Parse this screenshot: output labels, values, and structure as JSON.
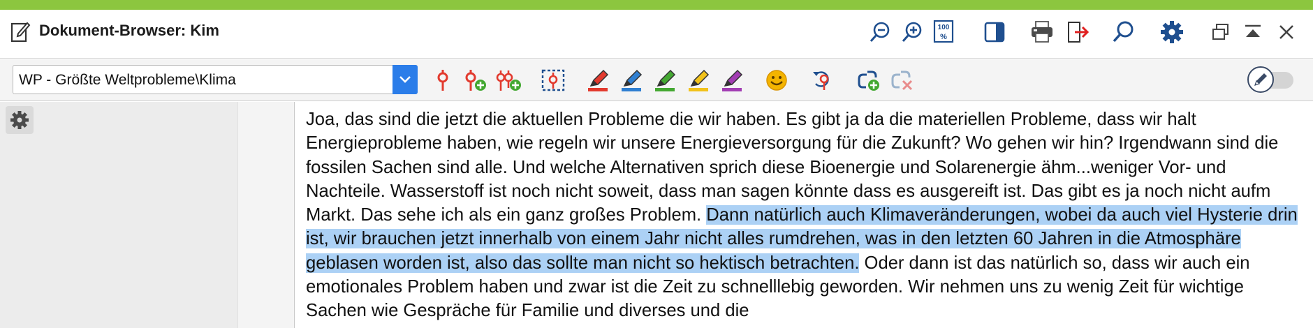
{
  "window": {
    "title": "Dokument-Browser: Kim",
    "accent_color": "#8cc63f"
  },
  "titlebar": {
    "buttons": [
      {
        "name": "zoom-out-icon"
      },
      {
        "name": "zoom-in-icon"
      },
      {
        "name": "zoom-100-icon",
        "label": "100"
      },
      {
        "name": "panel-layout-icon"
      },
      {
        "name": "print-icon"
      },
      {
        "name": "export-icon"
      },
      {
        "name": "search-icon"
      },
      {
        "name": "gear-icon"
      },
      {
        "name": "undock-icon"
      },
      {
        "name": "collapse-up-icon"
      },
      {
        "name": "close-icon"
      }
    ]
  },
  "toolbar": {
    "document_path": "WP - Größte Weltprobleme\\Klima",
    "dropdown_icon": "chevron-down-icon",
    "tools": [
      "code-icon",
      "code-add-icon",
      "code-add-multi-icon",
      "select-code-icon",
      "highlighter-red-icon",
      "highlighter-blue-icon",
      "highlighter-green-icon",
      "highlighter-yellow-icon",
      "highlighter-purple-icon",
      "emoticon-icon",
      "undo-code-icon",
      "link-add-icon",
      "link-remove-icon"
    ],
    "edit_toggle_icon": "pencil-icon",
    "colors": {
      "red": "#e23a2e",
      "blue": "#2f7fd1",
      "green": "#44a832",
      "yellow": "#f1c21b",
      "purple": "#a23db3",
      "select_blue": "#2b7de9"
    }
  },
  "sidebar": {
    "settings_icon": "gear-icon"
  },
  "document": {
    "text_before": " Joa, das sind die jetzt die aktuellen Probleme die wir haben. Es gibt ja da die materiellen Probleme, dass wir halt Energieprobleme haben, wie regeln wir unsere Energieversorgung für die Zukunft? Wo gehen wir hin? Irgendwann sind die fossilen Sachen sind alle. Und welche Alternativen sprich diese Bioenergie und Solarenergie ähm...weniger Vor- und Nachteile. Wasserstoff ist noch nicht soweit, dass man sagen könnte dass es ausgereift ist. Das gibt es ja noch nicht aufm Markt. Das sehe ich als ein ganz großes Problem. ",
    "text_highlighted": "Dann natürlich auch Klimaveränderungen, wobei da auch viel Hysterie drin ist, wir brauchen jetzt innerhalb von einem Jahr nicht alles rumdrehen, was in den letzten 60 Jahren in die Atmosphäre geblasen worden ist, also das sollte man nicht so hektisch betrachten.",
    "text_after": " Oder dann ist das natürlich so, dass wir auch ein emotionales Problem haben und zwar ist die Zeit zu schnelllebig geworden. Wir nehmen uns zu wenig Zeit für wichtige Sachen wie Gespräche für Familie und diverses und die",
    "highlight_color": "#acd1f5"
  }
}
